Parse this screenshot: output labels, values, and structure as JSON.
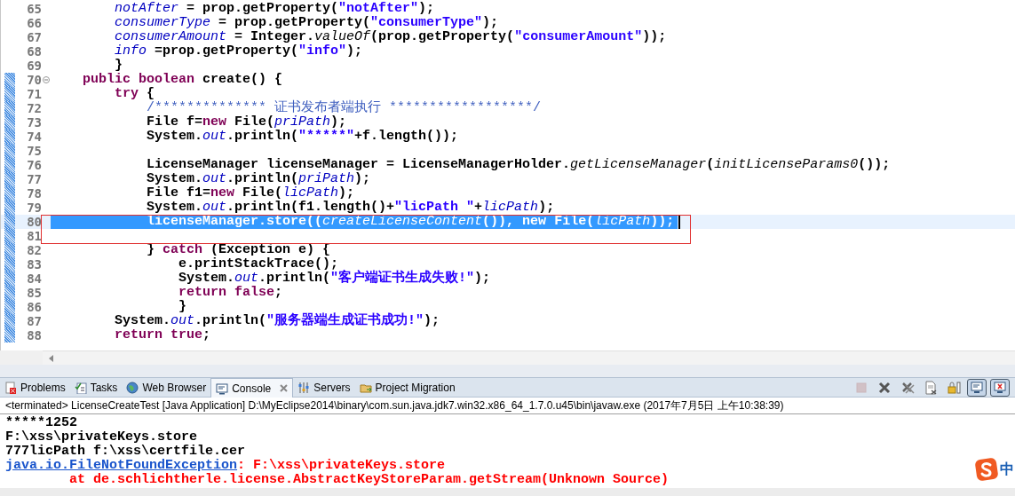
{
  "editor": {
    "lines": [
      {
        "number": "65",
        "changed": false,
        "selected": false,
        "tokens": [
          {
            "kind": "field",
            "text": "        notAfter"
          },
          {
            "kind": "plain",
            "text": " = prop.getProperty("
          },
          {
            "kind": "string",
            "text": "\"notAfter\""
          },
          {
            "kind": "plain",
            "text": ");"
          }
        ]
      },
      {
        "number": "66",
        "changed": false,
        "selected": false,
        "tokens": [
          {
            "kind": "field",
            "text": "        consumerType"
          },
          {
            "kind": "plain",
            "text": " = prop.getProperty("
          },
          {
            "kind": "string",
            "text": "\"consumerType\""
          },
          {
            "kind": "plain",
            "text": ");"
          }
        ]
      },
      {
        "number": "67",
        "changed": false,
        "selected": false,
        "tokens": [
          {
            "kind": "field",
            "text": "        consumerAmount"
          },
          {
            "kind": "plain",
            "text": " = Integer."
          },
          {
            "kind": "static",
            "text": "valueOf"
          },
          {
            "kind": "plain",
            "text": "(prop.getProperty("
          },
          {
            "kind": "string",
            "text": "\"consumerAmount\""
          },
          {
            "kind": "plain",
            "text": "));"
          }
        ]
      },
      {
        "number": "68",
        "changed": false,
        "selected": false,
        "tokens": [
          {
            "kind": "field",
            "text": "        info"
          },
          {
            "kind": "plain",
            "text": " =prop.getProperty("
          },
          {
            "kind": "string",
            "text": "\"info\""
          },
          {
            "kind": "plain",
            "text": ");"
          }
        ]
      },
      {
        "number": "69",
        "changed": false,
        "selected": false,
        "tokens": [
          {
            "kind": "plain",
            "text": "        }"
          }
        ]
      },
      {
        "number": "70",
        "changed": true,
        "selected": false,
        "collapsible": true,
        "tokens": [
          {
            "kind": "keyword",
            "text": "    public boolean"
          },
          {
            "kind": "plain",
            "text": " create() {"
          }
        ]
      },
      {
        "number": "71",
        "changed": true,
        "selected": false,
        "tokens": [
          {
            "kind": "keyword",
            "text": "        try"
          },
          {
            "kind": "plain",
            "text": " {"
          }
        ]
      },
      {
        "number": "72",
        "changed": true,
        "selected": false,
        "tokens": [
          {
            "kind": "comment",
            "text": "            /************** 证书发布者端执行 ******************/"
          }
        ]
      },
      {
        "number": "73",
        "changed": true,
        "selected": false,
        "tokens": [
          {
            "kind": "plain",
            "text": "            File f="
          },
          {
            "kind": "keyword",
            "text": "new"
          },
          {
            "kind": "plain",
            "text": " File("
          },
          {
            "kind": "field",
            "text": "priPath"
          },
          {
            "kind": "plain",
            "text": ");"
          }
        ]
      },
      {
        "number": "74",
        "changed": true,
        "selected": false,
        "tokens": [
          {
            "kind": "plain",
            "text": "            System."
          },
          {
            "kind": "field",
            "text": "out"
          },
          {
            "kind": "plain",
            "text": ".println("
          },
          {
            "kind": "string",
            "text": "\"*****\""
          },
          {
            "kind": "plain",
            "text": "+f.length());"
          }
        ]
      },
      {
        "number": "75",
        "changed": true,
        "selected": false
      },
      {
        "number": "76",
        "changed": true,
        "selected": false,
        "tokens": [
          {
            "kind": "plain",
            "text": "            LicenseManager licenseManager = LicenseManagerHolder."
          },
          {
            "kind": "static",
            "text": "getLicenseManager"
          },
          {
            "kind": "plain",
            "text": "("
          },
          {
            "kind": "static",
            "text": "initLicenseParams0"
          },
          {
            "kind": "plain",
            "text": "());"
          }
        ]
      },
      {
        "number": "77",
        "changed": true,
        "selected": false,
        "tokens": [
          {
            "kind": "plain",
            "text": "            System."
          },
          {
            "kind": "field",
            "text": "out"
          },
          {
            "kind": "plain",
            "text": ".println("
          },
          {
            "kind": "field",
            "text": "priPath"
          },
          {
            "kind": "plain",
            "text": ");"
          }
        ]
      },
      {
        "number": "78",
        "changed": true,
        "selected": false,
        "tokens": [
          {
            "kind": "plain",
            "text": "            File f1="
          },
          {
            "kind": "keyword",
            "text": "new"
          },
          {
            "kind": "plain",
            "text": " File("
          },
          {
            "kind": "field",
            "text": "licPath"
          },
          {
            "kind": "plain",
            "text": ");"
          }
        ]
      },
      {
        "number": "79",
        "changed": true,
        "selected": false,
        "tokens": [
          {
            "kind": "plain",
            "text": "            System."
          },
          {
            "kind": "field",
            "text": "out"
          },
          {
            "kind": "plain",
            "text": ".println(f1.length()+"
          },
          {
            "kind": "string",
            "text": "\"licPath \""
          },
          {
            "kind": "plain",
            "text": "+"
          },
          {
            "kind": "field",
            "text": "licPath"
          },
          {
            "kind": "plain",
            "text": ");"
          }
        ]
      },
      {
        "number": "80",
        "changed": true,
        "selected": true,
        "tokens": [
          {
            "kind": "plain",
            "text": "            licenseManager.store(("
          },
          {
            "kind": "static",
            "text": "createLicenseContent"
          },
          {
            "kind": "plain",
            "text": "()), "
          },
          {
            "kind": "keyword",
            "text": "new"
          },
          {
            "kind": "plain",
            "text": " File("
          },
          {
            "kind": "field",
            "text": "licPath"
          },
          {
            "kind": "plain",
            "text": "));"
          }
        ]
      },
      {
        "number": "81",
        "changed": true,
        "selected": false
      },
      {
        "number": "82",
        "changed": true,
        "selected": false,
        "tokens": [
          {
            "kind": "plain",
            "text": "            } "
          },
          {
            "kind": "keyword",
            "text": "catch"
          },
          {
            "kind": "plain",
            "text": " (Exception e) {"
          }
        ]
      },
      {
        "number": "83",
        "changed": true,
        "selected": false,
        "tokens": [
          {
            "kind": "plain",
            "text": "                e.printStackTrace();"
          }
        ]
      },
      {
        "number": "84",
        "changed": true,
        "selected": false,
        "tokens": [
          {
            "kind": "plain",
            "text": "                System."
          },
          {
            "kind": "field",
            "text": "out"
          },
          {
            "kind": "plain",
            "text": ".println("
          },
          {
            "kind": "string",
            "text": "\"客户端证书生成失败!\""
          },
          {
            "kind": "plain",
            "text": ");"
          }
        ]
      },
      {
        "number": "85",
        "changed": true,
        "selected": false,
        "tokens": [
          {
            "kind": "keyword",
            "text": "                return false"
          },
          {
            "kind": "plain",
            "text": ";"
          }
        ]
      },
      {
        "number": "86",
        "changed": true,
        "selected": false,
        "tokens": [
          {
            "kind": "plain",
            "text": "                }"
          }
        ]
      },
      {
        "number": "87",
        "changed": true,
        "selected": false,
        "tokens": [
          {
            "kind": "plain",
            "text": "        System."
          },
          {
            "kind": "field",
            "text": "out"
          },
          {
            "kind": "plain",
            "text": ".println("
          },
          {
            "kind": "string",
            "text": "\"服务器端生成证书成功!\""
          },
          {
            "kind": "plain",
            "text": ");"
          }
        ]
      },
      {
        "number": "88",
        "changed": true,
        "selected": false,
        "tokens": [
          {
            "kind": "keyword",
            "text": "        return true"
          },
          {
            "kind": "plain",
            "text": ";"
          }
        ]
      }
    ]
  },
  "console_view": {
    "tabs": [
      {
        "label": "Problems",
        "kind": "problems",
        "selected": false
      },
      {
        "label": "Tasks",
        "kind": "tasks",
        "selected": false
      },
      {
        "label": "Web Browser",
        "kind": "browser",
        "selected": false
      },
      {
        "label": "Console",
        "kind": "console",
        "selected": true
      },
      {
        "label": "Servers",
        "kind": "servers",
        "selected": false
      },
      {
        "label": "Project Migration",
        "kind": "migration",
        "selected": false
      }
    ],
    "toolbar": [
      {
        "kind": "stop",
        "disabled": true,
        "pressed": false
      },
      {
        "kind": "remove",
        "disabled": false,
        "pressed": false
      },
      {
        "kind": "remove_all",
        "disabled": false,
        "pressed": false
      },
      {
        "kind": "clear",
        "disabled": false,
        "pressed": false
      },
      {
        "kind": "scroll_lock",
        "disabled": false,
        "pressed": false
      },
      {
        "kind": "show_out",
        "disabled": false,
        "pressed": true
      },
      {
        "kind": "show_err",
        "disabled": false,
        "pressed": true
      }
    ],
    "process_label": "<terminated> LicenseCreateTest [Java Application] D:\\MyEclipse2014\\binary\\com.sun.java.jdk7.win32.x86_64_1.7.0.u45\\bin\\javaw.exe (2017年7月5日 上午10:38:39)",
    "output": [
      {
        "parts": [
          {
            "kind": "out",
            "text": "*****1252"
          }
        ]
      },
      {
        "parts": [
          {
            "kind": "out",
            "text": "F:\\xss\\privateKeys.store"
          }
        ]
      },
      {
        "parts": [
          {
            "kind": "out",
            "text": "777licPath f:\\xss\\certfile.cer"
          }
        ]
      },
      {
        "parts": [
          {
            "kind": "link",
            "text": "java.io.FileNotFoundException"
          },
          {
            "kind": "err",
            "text": ": F:\\xss\\privateKeys.store"
          }
        ]
      },
      {
        "parts": [
          {
            "kind": "err",
            "text": "\tat de.schlichtherle.license.AbstractKeyStoreParam.getStream(Unknown Source)"
          }
        ]
      }
    ]
  },
  "ime_indicator": {
    "label": "中"
  }
}
